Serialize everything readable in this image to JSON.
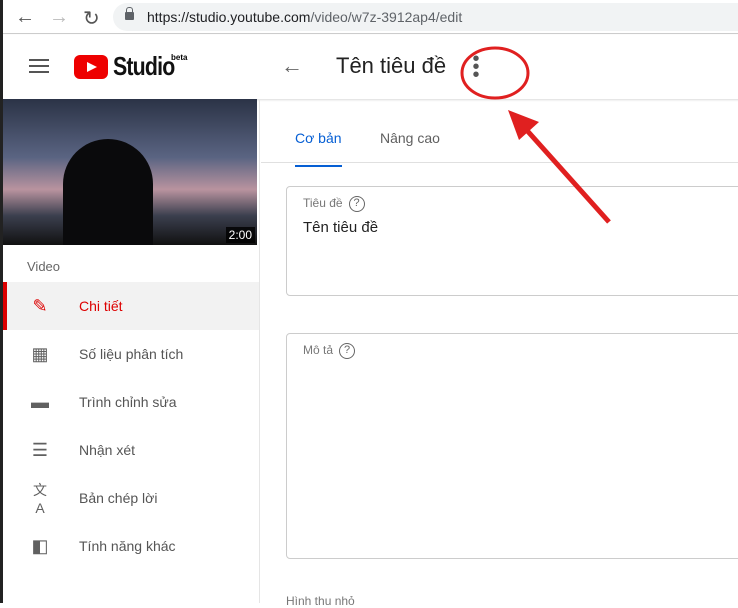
{
  "browser": {
    "url_host": "https://studio.youtube.com",
    "url_path": "/video/w7z-3912ap4/edit",
    "back": "←",
    "forward": "→",
    "reload": "↻"
  },
  "header": {
    "logo": "Studio",
    "beta": "beta",
    "page_title": "Tên tiêu đề",
    "back": "←",
    "more": "⋮"
  },
  "video": {
    "duration": "2:00",
    "section": "Video"
  },
  "sidebar": {
    "items": [
      {
        "label": "Chi tiết",
        "icon": "✎"
      },
      {
        "label": "Số liệu phân tích",
        "icon": "▦"
      },
      {
        "label": "Trình chỉnh sửa",
        "icon": "▬"
      },
      {
        "label": "Nhận xét",
        "icon": "☰"
      },
      {
        "label": "Bản chép lời",
        "icon": "文A"
      },
      {
        "label": "Tính năng khác",
        "icon": "◧"
      }
    ]
  },
  "tabs": [
    {
      "label": "Cơ bản"
    },
    {
      "label": "Nâng cao"
    }
  ],
  "form": {
    "title_label": "Tiêu đề",
    "title_value": "Tên tiêu đề",
    "desc_label": "Mô tả",
    "help": "?",
    "thumbnail_label": "Hình thu nhỏ"
  },
  "annotation": {
    "color": "#e02020"
  }
}
